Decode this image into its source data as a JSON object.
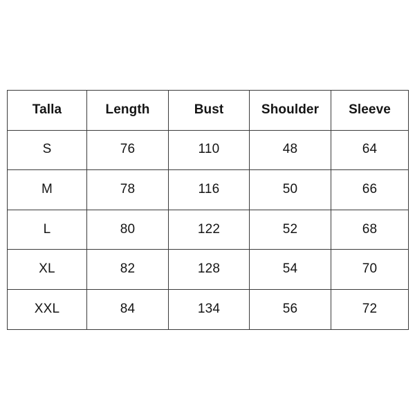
{
  "page": {
    "background_color": "#ffffff",
    "border_color": "#3a3a3a",
    "text_color": "#141414"
  },
  "chart_data": {
    "type": "table",
    "title": "",
    "columns": [
      "Talla",
      "Length",
      "Bust",
      "Shoulder",
      "Sleeve"
    ],
    "rows": [
      [
        "S",
        "76",
        "110",
        "48",
        "64"
      ],
      [
        "M",
        "78",
        "116",
        "50",
        "66"
      ],
      [
        "L",
        "80",
        "122",
        "52",
        "68"
      ],
      [
        "XL",
        "82",
        "128",
        "54",
        "70"
      ],
      [
        "XXL",
        "84",
        "134",
        "56",
        "72"
      ]
    ]
  },
  "size_chart": {
    "headers": {
      "size": "Talla",
      "length": "Length",
      "bust": "Bust",
      "shoulder": "Shoulder",
      "sleeve": "Sleeve"
    },
    "rows": [
      {
        "size": "S",
        "length": "76",
        "bust": "110",
        "shoulder": "48",
        "sleeve": "64"
      },
      {
        "size": "M",
        "length": "78",
        "bust": "116",
        "shoulder": "50",
        "sleeve": "66"
      },
      {
        "size": "L",
        "length": "80",
        "bust": "122",
        "shoulder": "52",
        "sleeve": "68"
      },
      {
        "size": "XL",
        "length": "82",
        "bust": "128",
        "shoulder": "54",
        "sleeve": "70"
      },
      {
        "size": "XXL",
        "length": "84",
        "bust": "134",
        "shoulder": "56",
        "sleeve": "72"
      }
    ]
  }
}
